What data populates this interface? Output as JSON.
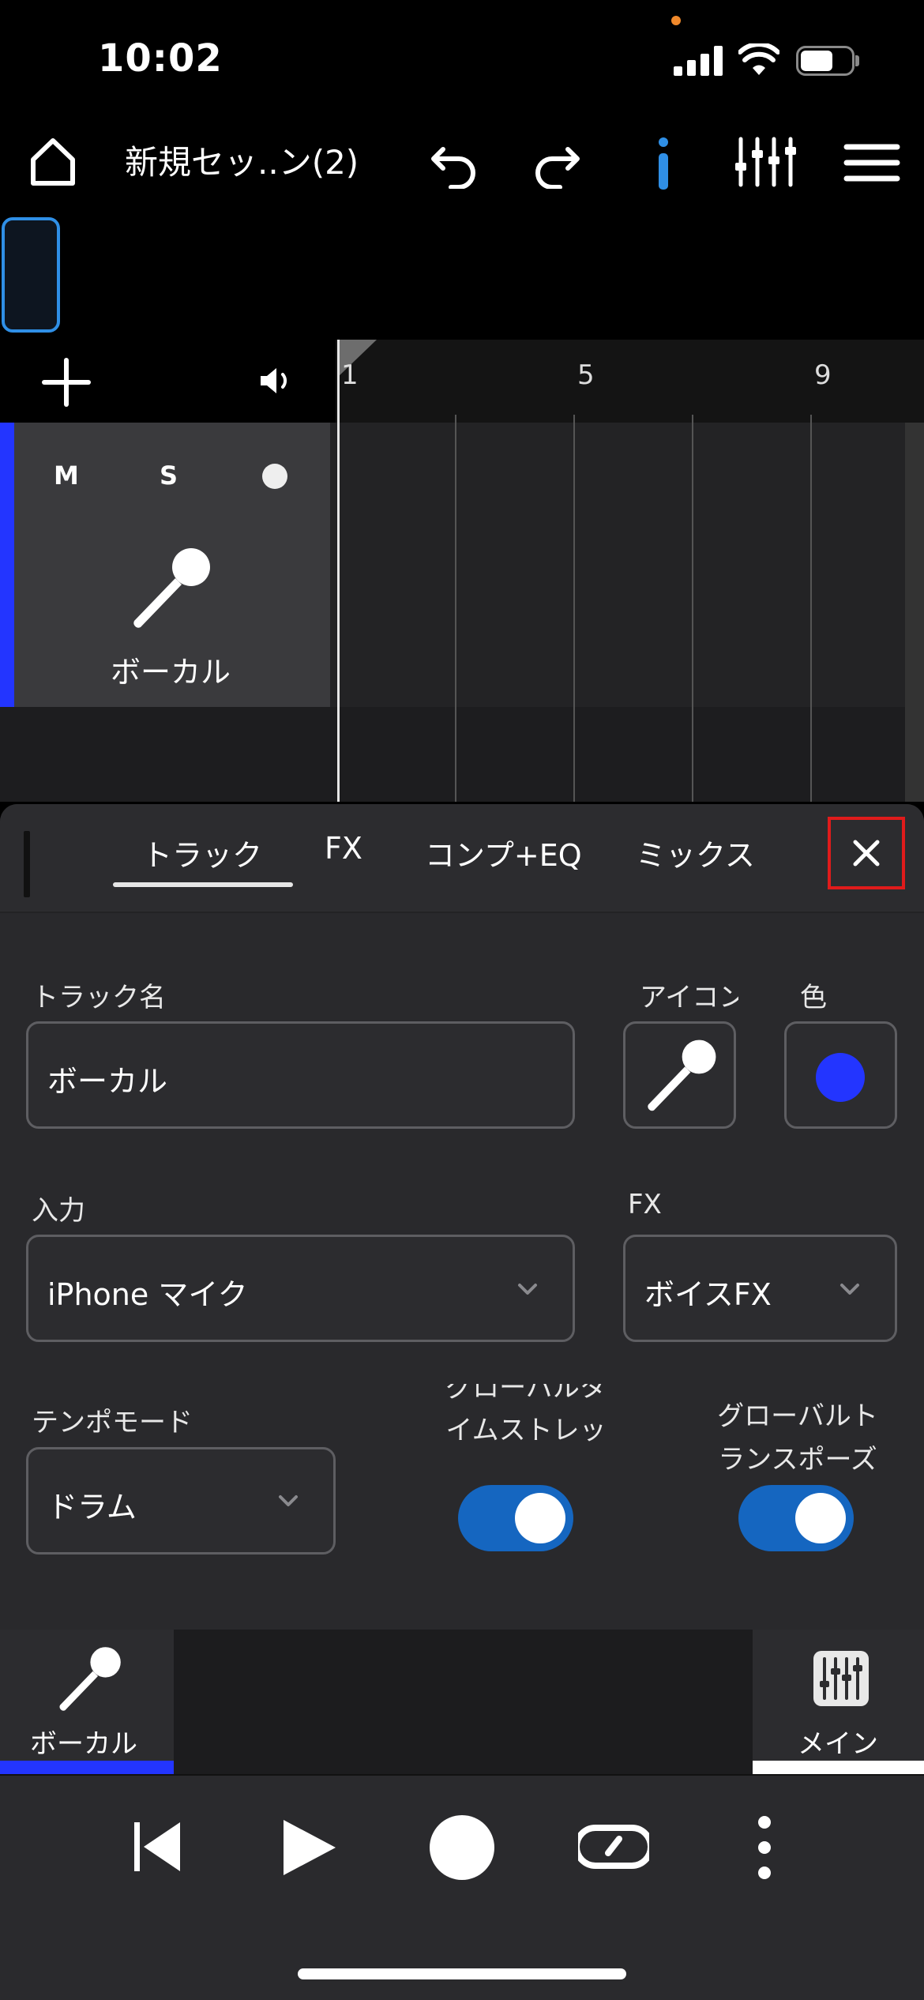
{
  "status_bar": {
    "time": "10:02"
  },
  "toolbar": {
    "session_title": "新規セッ..ン(2)",
    "icons": [
      "home-icon",
      "undo-icon",
      "redo-icon",
      "info-icon",
      "mixer-icon",
      "menu-icon"
    ],
    "accent_color": "#2f8fe6"
  },
  "timeline": {
    "ruler_marks": [
      "1",
      "5",
      "9"
    ]
  },
  "track": {
    "mute_label": "M",
    "solo_label": "S",
    "name": "ボーカル",
    "color": "#2335ff"
  },
  "inspector": {
    "tabs": [
      "トラック",
      "FX",
      "コンプ+EQ",
      "ミックス"
    ],
    "active_tab": "トラック",
    "track_name_label": "トラック名",
    "track_name_value": "ボーカル",
    "icon_label": "アイコン",
    "color_label": "色",
    "color_value": "#2335ff",
    "input_label": "入力",
    "input_value": "iPhone マイク",
    "fx_label": "FX",
    "fx_value": "ボイスFX",
    "tempo_label": "テンポモード",
    "tempo_value": "ドラム",
    "global_stretch_line1": "グローバルタ",
    "global_stretch_line2": "イムストレッ",
    "global_stretch_on": true,
    "global_transpose_line1": "グローバルト",
    "global_transpose_line2": "ランスポーズ",
    "global_transpose_on": true
  },
  "track_bar": {
    "left_label": "ボーカル",
    "right_label": "メイン"
  },
  "transport": {
    "icons": [
      "skip-back-icon",
      "play-icon",
      "record-icon",
      "loop-icon",
      "more-icon"
    ]
  }
}
